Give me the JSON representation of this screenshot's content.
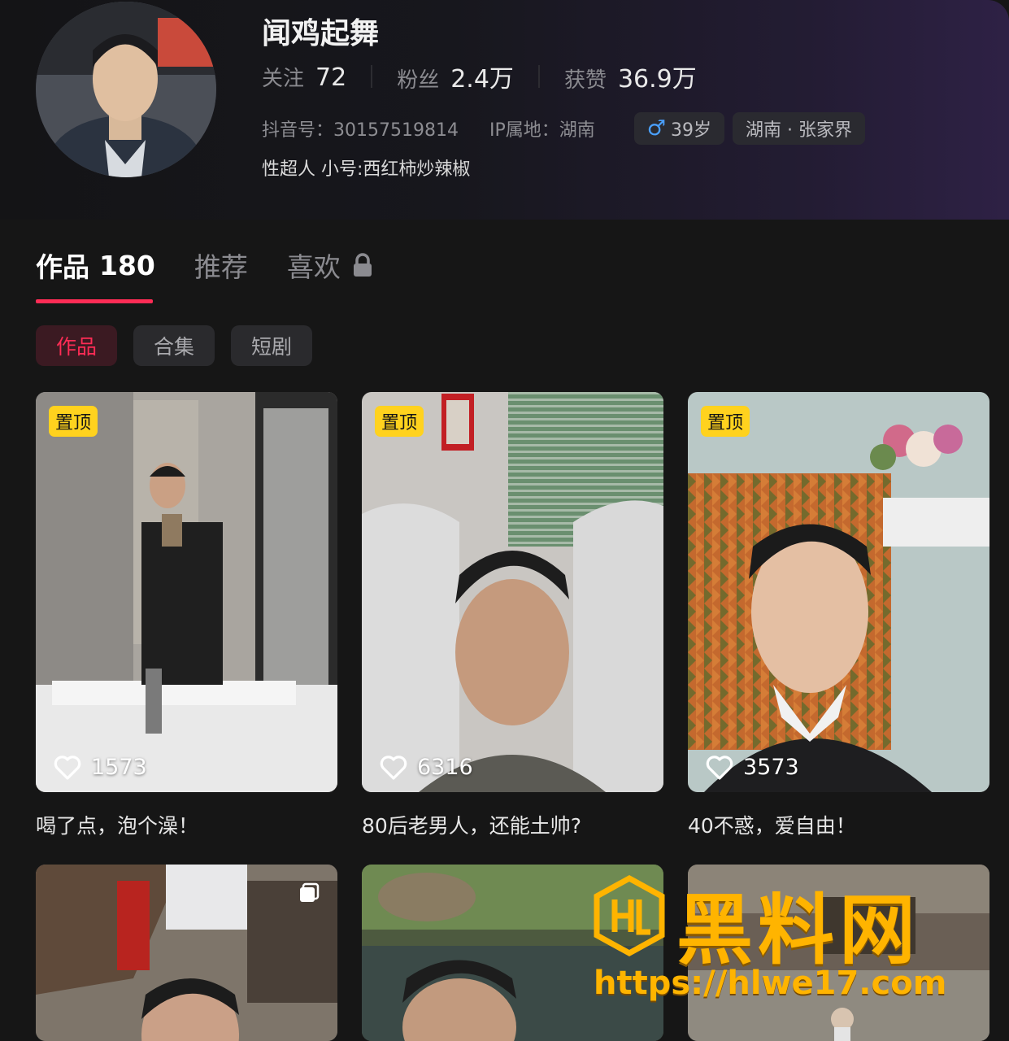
{
  "profile": {
    "username": "闻鸡起舞",
    "stats": [
      {
        "label": "关注",
        "value": "72"
      },
      {
        "label": "粉丝",
        "value": "2.4万"
      },
      {
        "label": "获赞",
        "value": "36.9万"
      }
    ],
    "douyin_id": "抖音号：30157519814",
    "ip_location": "IP属地：湖南",
    "age": "39岁",
    "location": "湖南 · 张家界",
    "bio": "性超人 小号:西红柿炒辣椒"
  },
  "tabs": {
    "works_label": "作品",
    "works_count": "180",
    "recommend_label": "推荐",
    "likes_label": "喜欢"
  },
  "chips": {
    "works": "作品",
    "collections": "合集",
    "short_drama": "短剧"
  },
  "videos": [
    {
      "pinned": "置顶",
      "likes": "1573",
      "caption": "喝了点，泡个澡！"
    },
    {
      "pinned": "置顶",
      "likes": "6316",
      "caption": "80后老男人，还能土帅?"
    },
    {
      "pinned": "置顶",
      "likes": "3573",
      "caption": "40不惑，爱自由！"
    }
  ],
  "watermark": {
    "title": "黑料网",
    "url": "https://hlwe17.com"
  },
  "colors": {
    "accent": "#fe2c55",
    "pin_badge": "#ffd21e",
    "male_icon": "#4aa0ff",
    "watermark": "#ffb400"
  }
}
